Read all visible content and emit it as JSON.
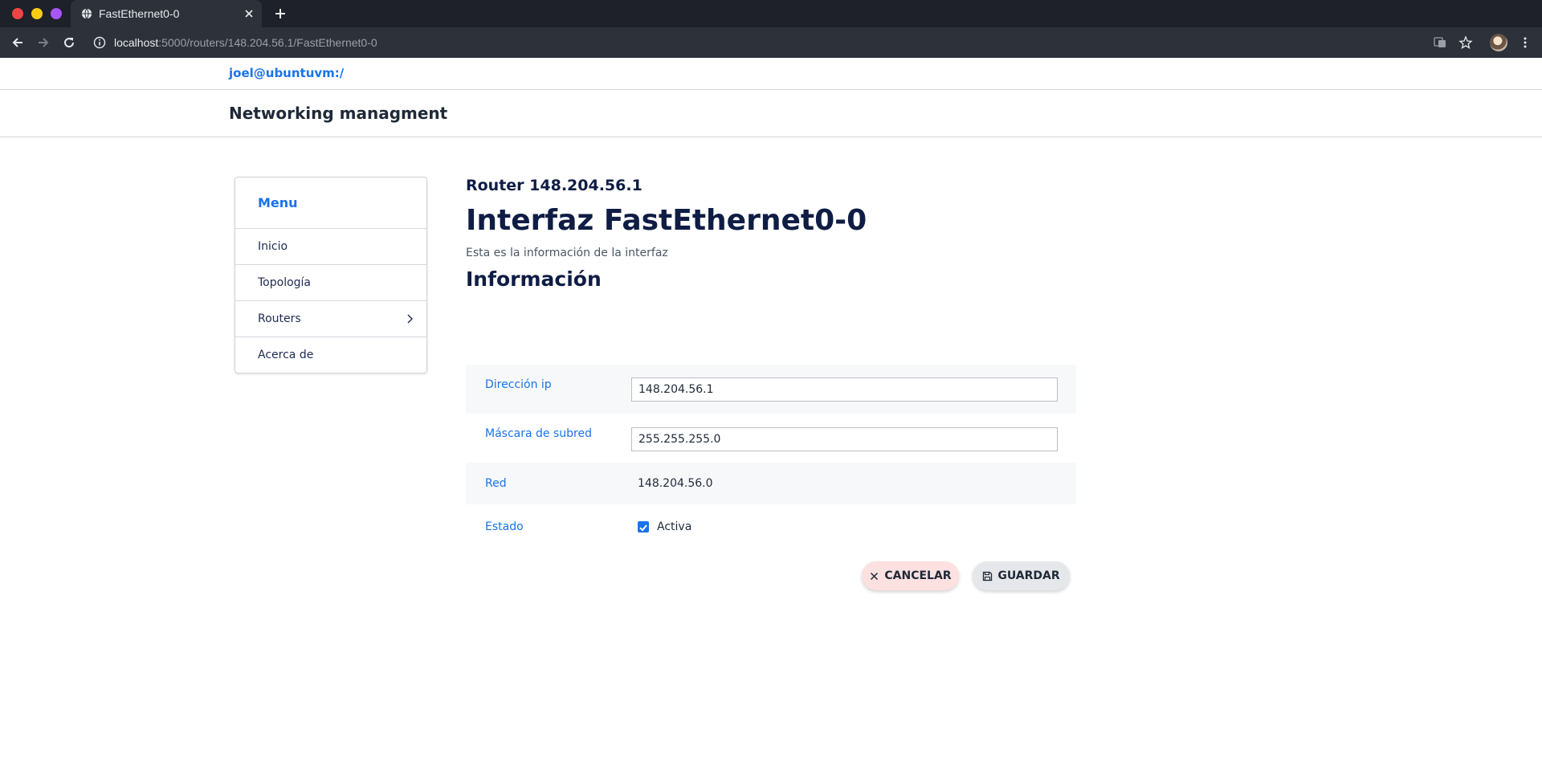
{
  "browser": {
    "tab_title": "FastEthernet0-0",
    "url_host": "localhost",
    "url_path": ":5000/routers/148.204.56.1/FastEthernet0-0"
  },
  "header": {
    "user": "joel@ubuntuvm:/",
    "brand": "Networking managment"
  },
  "sidebar": {
    "title": "Menu",
    "items": [
      {
        "label": "Inicio"
      },
      {
        "label": "Topología"
      },
      {
        "label": "Routers"
      },
      {
        "label": "Acerca de"
      }
    ]
  },
  "main": {
    "router_title": "Router 148.204.56.1",
    "interface_title": "Interfaz FastEthernet0-0",
    "description": "Esta es la información de la interfaz",
    "section_title": "Información",
    "fields": {
      "ip_label": "Dirección ip",
      "ip_value": "148.204.56.1",
      "mask_label": "Máscara de subred",
      "mask_value": "255.255.255.0",
      "network_label": "Red",
      "network_value": "148.204.56.0",
      "state_label": "Estado",
      "state_checked": true,
      "state_text": "Activa"
    },
    "buttons": {
      "cancel": "CANCELAR",
      "save": "GUARDAR"
    }
  },
  "colors": {
    "accent": "#1a73e8",
    "heading": "#0f1d45",
    "cancel_bg": "#fde0e0",
    "save_bg": "#e6e7ea"
  }
}
